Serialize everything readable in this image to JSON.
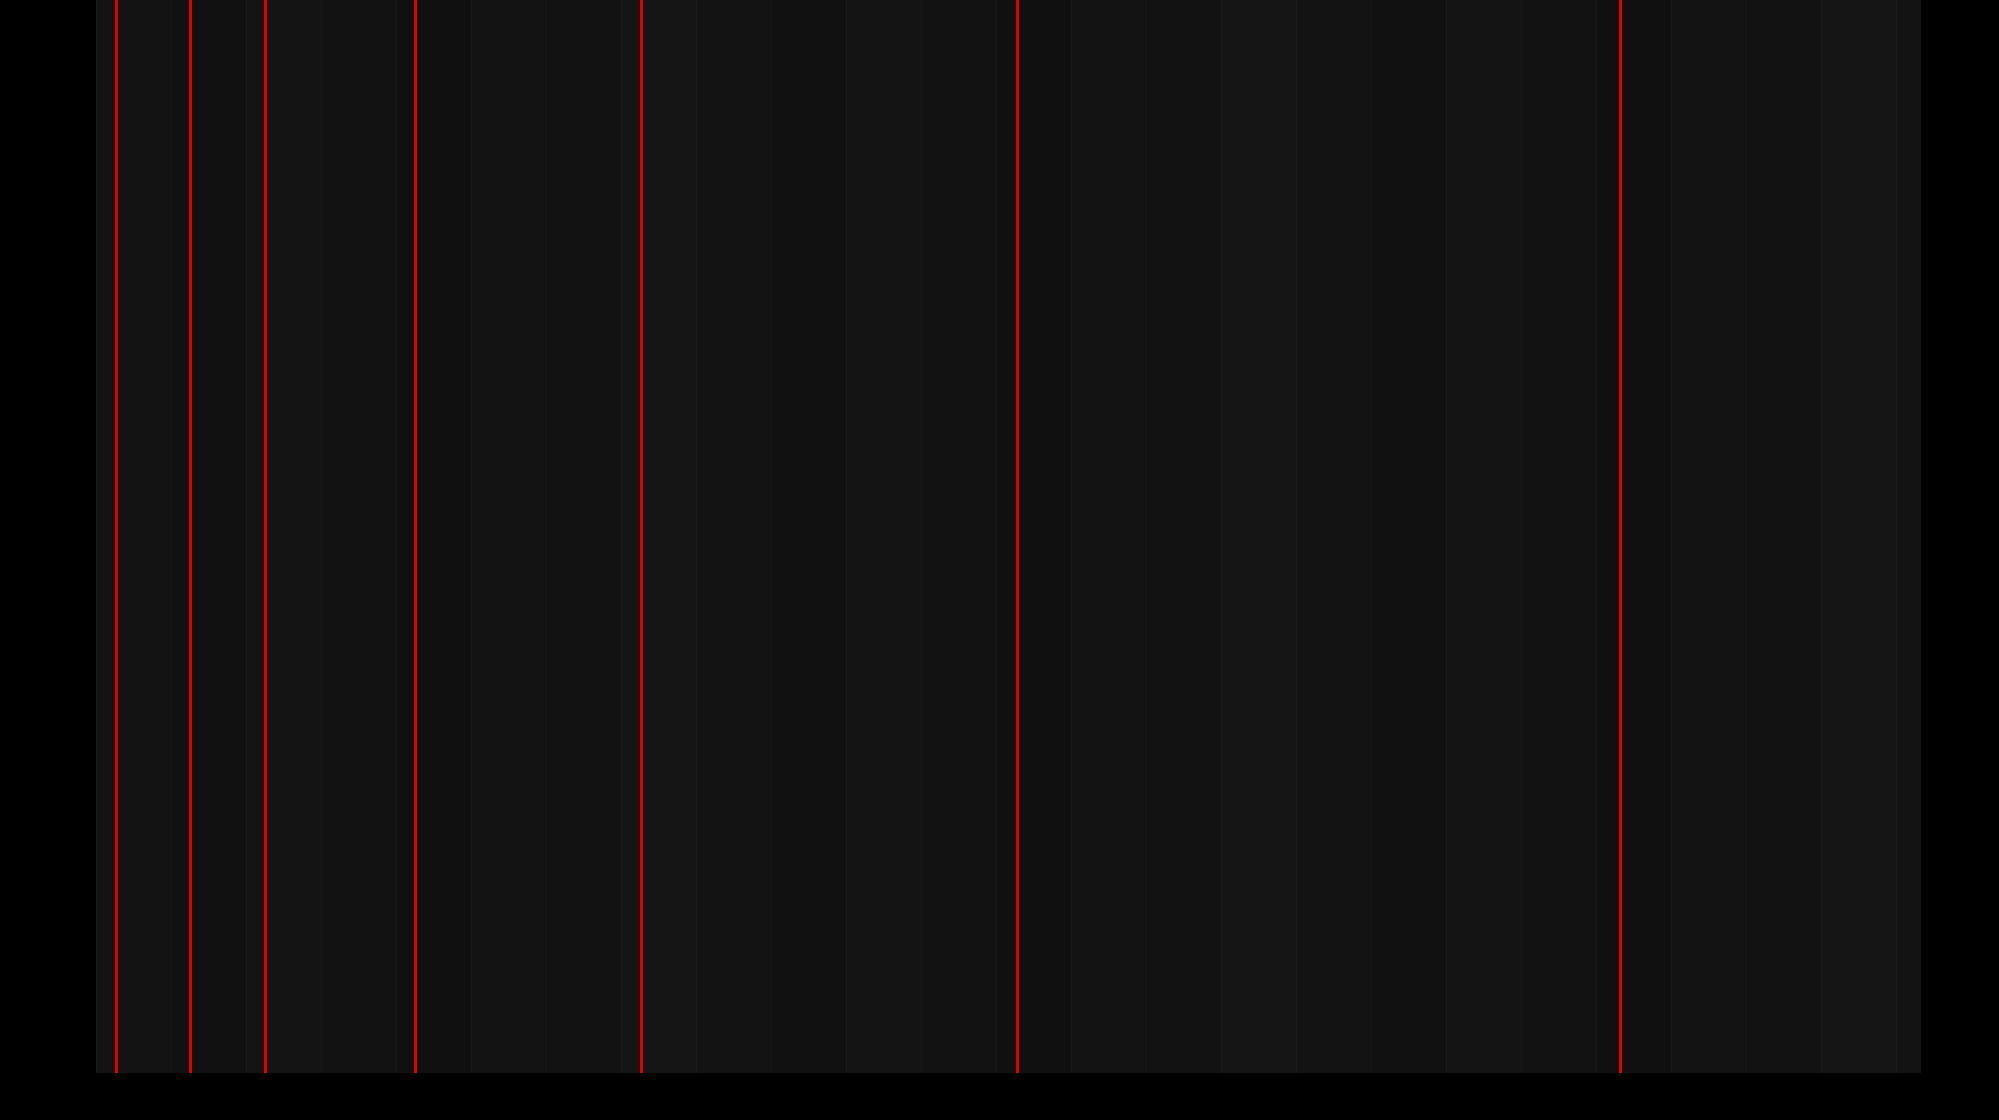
{
  "screen": {
    "background_color": "#000000",
    "stage_color": "#121212",
    "stripe_colors": [
      "#131313",
      "#111111",
      "#141414",
      "#121212",
      "#101010",
      "#131313",
      "#121212",
      "#151515"
    ],
    "line_color": "#e00000",
    "red_line_count": 7
  }
}
